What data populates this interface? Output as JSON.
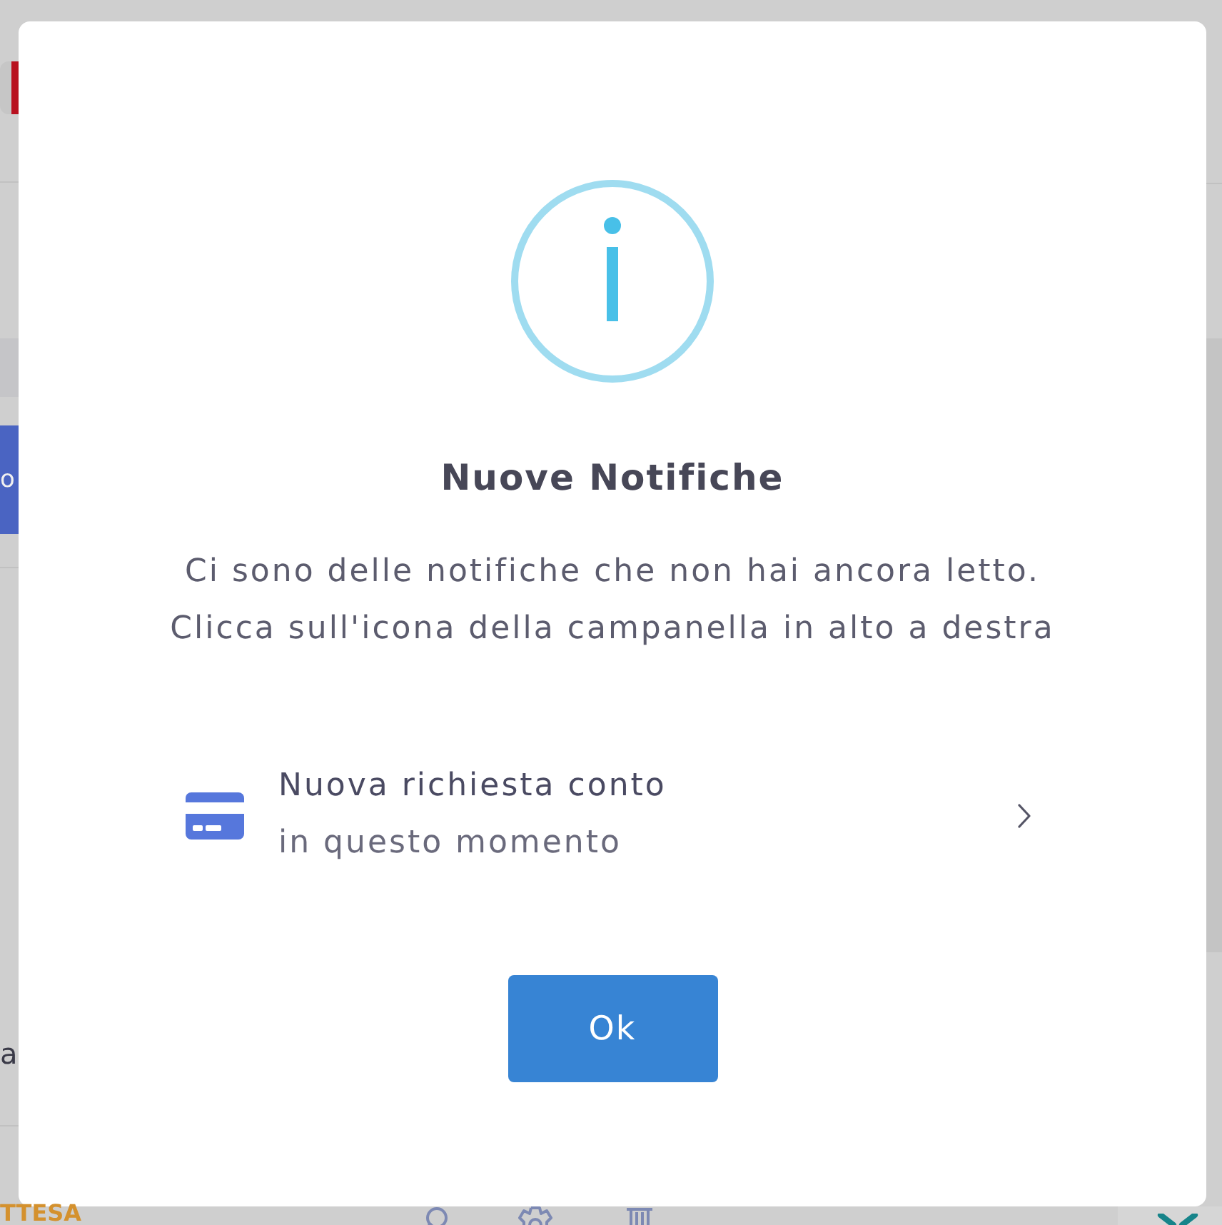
{
  "background_page": {
    "button_label": "o",
    "text": "a",
    "status": "TTESA"
  },
  "dialog": {
    "title": "Nuove Notifiche",
    "message_lines": [
      "Ci sono delle notifiche che non hai ancora letto.",
      "Clicca sull'icona della campanella in alto a destra"
    ],
    "notifications": [
      {
        "title": "Nuova richiesta conto",
        "time": "in questo momento"
      }
    ],
    "buttons": [
      "Ok"
    ]
  }
}
